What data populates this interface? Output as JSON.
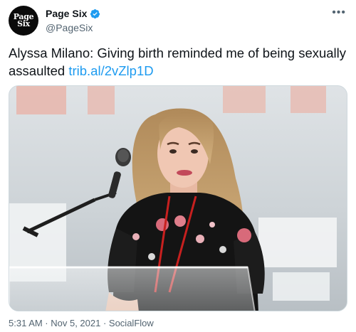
{
  "account": {
    "display_name": "Page Six",
    "handle": "@PageSix",
    "avatar_text": [
      "Page",
      "Six"
    ],
    "verified": true
  },
  "tweet": {
    "text": "Alyssa Milano: Giving birth reminded me of being sexually assaulted",
    "link": "trib.al/2vZlp1D",
    "timestamp": "5:31 AM · Nov 5, 2021 · SocialFlow"
  },
  "icons": {
    "verified": "verified-badge-icon",
    "more": "more-options-icon"
  },
  "colors": {
    "link": "#1d9bf0",
    "secondary_text": "#536471",
    "verified": "#1d9bf0"
  }
}
